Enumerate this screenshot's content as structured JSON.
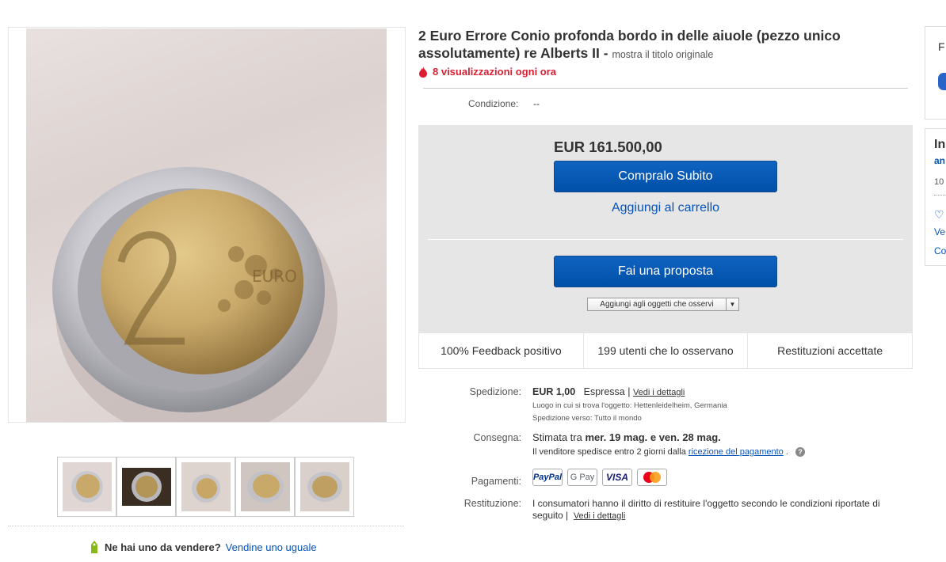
{
  "listing": {
    "title": "2 Euro Errore Conio profonda bordo in delle aiuole (pezzo unico assolutamente) re Alberts II -",
    "show_original": "mostra il titolo originale",
    "views": "8 visualizzazioni ogni ora",
    "condition_label": "Condizione:",
    "condition_value": "--"
  },
  "buybox": {
    "price": "EUR 161.500,00",
    "buy_now": "Compralo Subito",
    "add_to_cart": "Aggiungi al carrello",
    "make_offer": "Fai una proposta",
    "watch": "Aggiungi agli oggetti che osservi"
  },
  "stats": [
    "100% Feedback positivo",
    "199 utenti che lo osservano",
    "Restituzioni accettate"
  ],
  "shipping": {
    "label": "Spedizione:",
    "price": "EUR 1,00",
    "method": "Espressa |",
    "details_link": "Vedi i dettagli",
    "location": "Luogo in cui si trova l'oggetto:  Hettenleidelheim, Germania",
    "ships_to": "Spedizione verso:  Tutto il mondo"
  },
  "delivery": {
    "label": "Consegna:",
    "prefix": "Stimata tra",
    "dates": "mer. 19 mag. e ven. 28 mag.",
    "sub_prefix": "Il venditore spedisce entro 2 giorni dalla",
    "sub_link": "ricezione del pagamento",
    "sub_suffix": "."
  },
  "payments": {
    "label": "Pagamenti:",
    "paypal": "PayPal",
    "gpay": "G Pay",
    "visa": "VISA"
  },
  "returns": {
    "label": "Restituzione:",
    "text": "I consumatori hanno il diritto di restituire l'oggetto secondo le condizioni riportate di seguito |",
    "link": "Vedi i dettagli"
  },
  "sell": {
    "question": "Ne hai uno da vendere?",
    "link": "Vendine uno uguale"
  },
  "right_panel": {
    "p1_title": "F",
    "p2_title": "In",
    "p2_seller": "an",
    "p2_count": "10",
    "p2_link1": "Ve",
    "p2_link2": "Co"
  },
  "colors": {
    "brand_blue": "#0654ba",
    "button_blue": "#0f63c0",
    "alert_red": "#dd1e31"
  }
}
